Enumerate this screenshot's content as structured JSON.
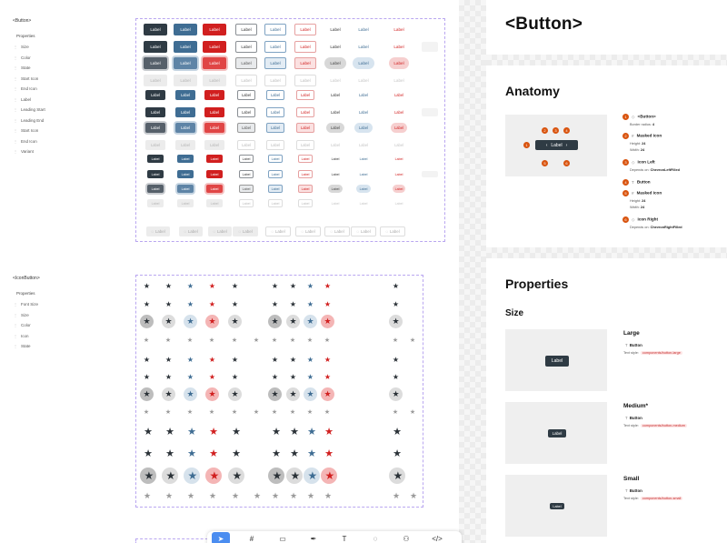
{
  "canvas": {
    "button_section": {
      "title": "<Button>",
      "properties_heading": "Properties",
      "properties": [
        "Size",
        "Color",
        "State",
        "Start Icon",
        "End Icon",
        "Label",
        "Leading Start",
        "Leading End",
        "Start Icon",
        "End Icon",
        "Variant"
      ],
      "button_label": "Label"
    },
    "iconbutton_section": {
      "title": "<IconButton>",
      "properties_heading": "Properties",
      "properties": [
        "Font Size",
        "Size",
        "Color",
        "Icon",
        "State"
      ],
      "icon_glyph": "★"
    }
  },
  "docs": {
    "title": "<Button>",
    "anatomy": {
      "heading": "Anatomy",
      "preview_label": "Label",
      "markers": [
        "1",
        "2",
        "3",
        "4",
        "5",
        "6"
      ],
      "items": [
        {
          "num": "1",
          "icon": "component-icon",
          "name": "<Button>",
          "details": [
            {
              "k": "Border radius",
              "v": "4"
            }
          ]
        },
        {
          "num": "2",
          "icon": "frame-icon",
          "name": "Masked Icon",
          "details": [
            {
              "k": "Height",
              "v": "24"
            },
            {
              "k": "Width",
              "v": "24"
            }
          ]
        },
        {
          "num": "3",
          "icon": "component-icon",
          "name": "Icon Left",
          "details": [
            {
              "k": "Depends on",
              "v": "ChevronLeftFilled"
            }
          ]
        },
        {
          "num": "4",
          "icon": "text-icon",
          "name": "Button",
          "details": []
        },
        {
          "num": "5",
          "icon": "frame-icon",
          "name": "Masked Icon",
          "details": [
            {
              "k": "Height",
              "v": "24"
            },
            {
              "k": "Width",
              "v": "24"
            }
          ]
        },
        {
          "num": "6",
          "icon": "component-icon",
          "name": "Icon Right",
          "details": [
            {
              "k": "Depends on",
              "v": "ChevronRightFilled"
            }
          ]
        }
      ]
    },
    "properties": {
      "heading": "Properties",
      "size_heading": "Size",
      "sizes": [
        {
          "title": "Large",
          "component": "Button",
          "text_style_label": "Text style",
          "text_style": "components/button-large",
          "button_label": "Label"
        },
        {
          "title": "Medium*",
          "component": "Button",
          "text_style_label": "Text style",
          "text_style": "components/button-medium",
          "button_label": "Label"
        },
        {
          "title": "Small",
          "component": "Button",
          "text_style_label": "Text style",
          "text_style": "components/button-small",
          "button_label": "Label"
        }
      ]
    }
  },
  "toolbar": {
    "tools": [
      {
        "name": "move-tool-icon",
        "glyph": "➤",
        "active": true
      },
      {
        "name": "frame-tool-icon",
        "glyph": "#",
        "active": false
      },
      {
        "name": "rectangle-tool-icon",
        "glyph": "▭",
        "active": false
      },
      {
        "name": "pen-tool-icon",
        "glyph": "✒",
        "active": false
      },
      {
        "name": "text-tool-icon",
        "glyph": "T",
        "active": false
      },
      {
        "name": "comment-tool-icon",
        "glyph": "◌",
        "active": false
      },
      {
        "name": "resources-tool-icon",
        "glyph": "⚇",
        "active": false
      },
      {
        "name": "code-tool-icon",
        "glyph": "</>",
        "active": false
      }
    ]
  },
  "colors": {
    "accent": "#4b8df0",
    "marker": "#d9540f",
    "button_dark": "#2f3b44",
    "button_blue": "#3f6d93",
    "button_red": "#d11f1f",
    "frame_border": "#b9a6f0"
  }
}
